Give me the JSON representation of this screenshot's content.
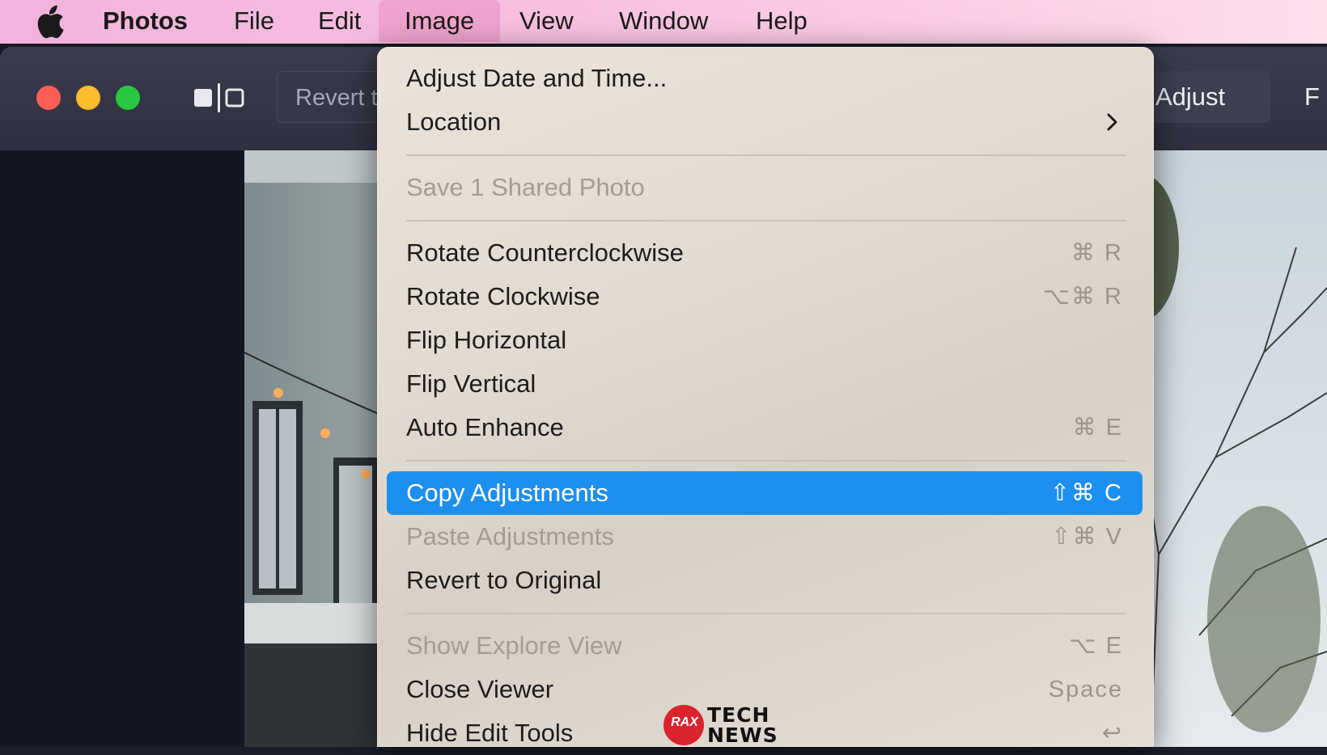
{
  "menubar": {
    "app_name": "Photos",
    "items": [
      "File",
      "Edit",
      "Image",
      "View",
      "Window",
      "Help"
    ],
    "open_menu": "Image"
  },
  "toolbar": {
    "revert_label": "Revert t",
    "adjust_label": "Adjust",
    "next_tab_label": "F"
  },
  "image_menu": {
    "items": [
      {
        "label": "Adjust Date and Time...",
        "shortcut": "",
        "enabled": true
      },
      {
        "label": "Location",
        "shortcut": "",
        "enabled": true,
        "submenu": true
      },
      {
        "label": "Save 1 Shared Photo",
        "shortcut": "",
        "enabled": false
      },
      {
        "label": "Rotate Counterclockwise",
        "shortcut": "⌘ R",
        "enabled": true
      },
      {
        "label": "Rotate Clockwise",
        "shortcut": "⌥⌘ R",
        "enabled": true
      },
      {
        "label": "Flip Horizontal",
        "shortcut": "",
        "enabled": true
      },
      {
        "label": "Flip Vertical",
        "shortcut": "",
        "enabled": true
      },
      {
        "label": "Auto Enhance",
        "shortcut": "⌘ E",
        "enabled": true
      },
      {
        "label": "Copy Adjustments",
        "shortcut": "⇧⌘ C",
        "enabled": true,
        "highlighted": true
      },
      {
        "label": "Paste Adjustments",
        "shortcut": "⇧⌘ V",
        "enabled": false
      },
      {
        "label": "Revert to Original",
        "shortcut": "",
        "enabled": true
      },
      {
        "label": "Show Explore View",
        "shortcut": "⌥ E",
        "enabled": false
      },
      {
        "label": "Close Viewer",
        "shortcut": "Space",
        "enabled": true
      },
      {
        "label": "Hide Edit Tools",
        "shortcut": "↩",
        "enabled": true
      }
    ]
  },
  "watermark": {
    "badge": "RAX",
    "line1": "TECH",
    "line2": "NEWS"
  },
  "colors": {
    "highlight": "#1d8ff0",
    "menubar": "#f7bfe0",
    "close": "#fd5f57",
    "minimize": "#febc2e",
    "zoom": "#28c840"
  }
}
